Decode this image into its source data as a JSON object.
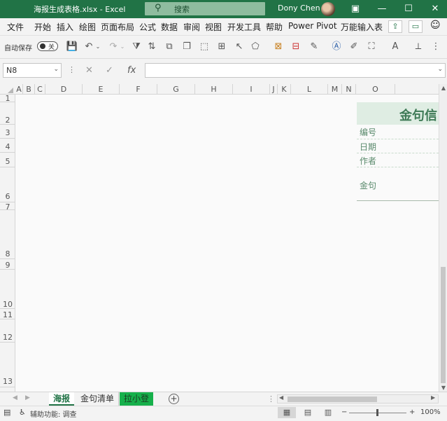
{
  "titlebar": {
    "document": "海报生成表格.xlsx  -  Excel",
    "search_placeholder": "搜索",
    "user": "Dony Chen",
    "ribbon_display_icon": "ribbon-display-icon",
    "minimize": "—",
    "maximize": "☐",
    "close": "✕"
  },
  "menu": {
    "items": [
      "文件",
      "开始",
      "插入",
      "绘图",
      "页面布局",
      "公式",
      "数据",
      "审阅",
      "视图",
      "开发工具",
      "帮助",
      "Power Pivot",
      "万能输入表"
    ],
    "share_icon": "share-icon",
    "comment_icon": "comment-icon",
    "smile_icon": "feedback-icon"
  },
  "qat": {
    "autosave_label": "自动保存",
    "toggle_state": "关",
    "icons": [
      "save-icon",
      "undo-icon",
      "redo-icon",
      "filter-icon",
      "sort-icon",
      "copy-format-icon",
      "group-icon",
      "select-icon",
      "pointer-icon",
      "shapes-icon",
      "insert-icon",
      "clear-icon",
      "picture-icon",
      "textbox-icon",
      "brush-icon",
      "fill-color-icon",
      "font-color-icon",
      "crop-icon",
      "more-icon"
    ]
  },
  "formula_bar": {
    "name_box": "N8",
    "formula": ""
  },
  "columns": [
    "A",
    "B",
    "C",
    "D",
    "E",
    "F",
    "G",
    "H",
    "I",
    "J",
    "K",
    "L",
    "M",
    "N",
    "O"
  ],
  "rows": [
    "1",
    "2",
    "3",
    "4",
    "5",
    "6",
    "7",
    "8",
    "9",
    "10",
    "11",
    "12",
    "13"
  ],
  "card": {
    "title": "金句信",
    "labels": [
      "编号",
      "日期",
      "作者",
      "金句"
    ]
  },
  "sheet_tabs": [
    "海报",
    "金句清单",
    "拉小登"
  ],
  "status": {
    "accessibility": "辅助功能: 调查",
    "zoom": "100%"
  }
}
